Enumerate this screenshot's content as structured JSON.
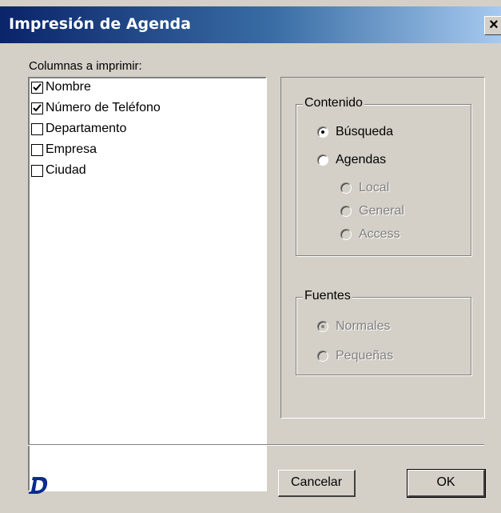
{
  "window": {
    "title": "Impresión de Agenda",
    "close_glyph": "×"
  },
  "columns": {
    "label": "Columnas a imprimir:",
    "items": [
      {
        "label": "Nombre",
        "checked": true
      },
      {
        "label": "Número de Teléfono",
        "checked": true
      },
      {
        "label": "Departamento",
        "checked": false
      },
      {
        "label": "Empresa",
        "checked": false
      },
      {
        "label": "Ciudad",
        "checked": false
      }
    ]
  },
  "contenido": {
    "legend": "Contenido",
    "busqueda": {
      "label": "Búsqueda",
      "selected": true
    },
    "agendas": {
      "label": "Agendas",
      "selected": false
    },
    "local": {
      "label": "Local",
      "enabled": false
    },
    "general": {
      "label": "General",
      "enabled": false
    },
    "access": {
      "label": "Access",
      "enabled": false
    }
  },
  "fuentes": {
    "legend": "Fuentes",
    "normales": {
      "label": "Normales",
      "selected": true,
      "enabled": false
    },
    "pequenas": {
      "label": "Pequeñas",
      "selected": false,
      "enabled": false
    }
  },
  "buttons": {
    "cancel_label": "Cancelar",
    "ok_label": "OK"
  },
  "logo": {
    "icon": "app-logo-d-icon",
    "color": "#0a2c8c"
  }
}
